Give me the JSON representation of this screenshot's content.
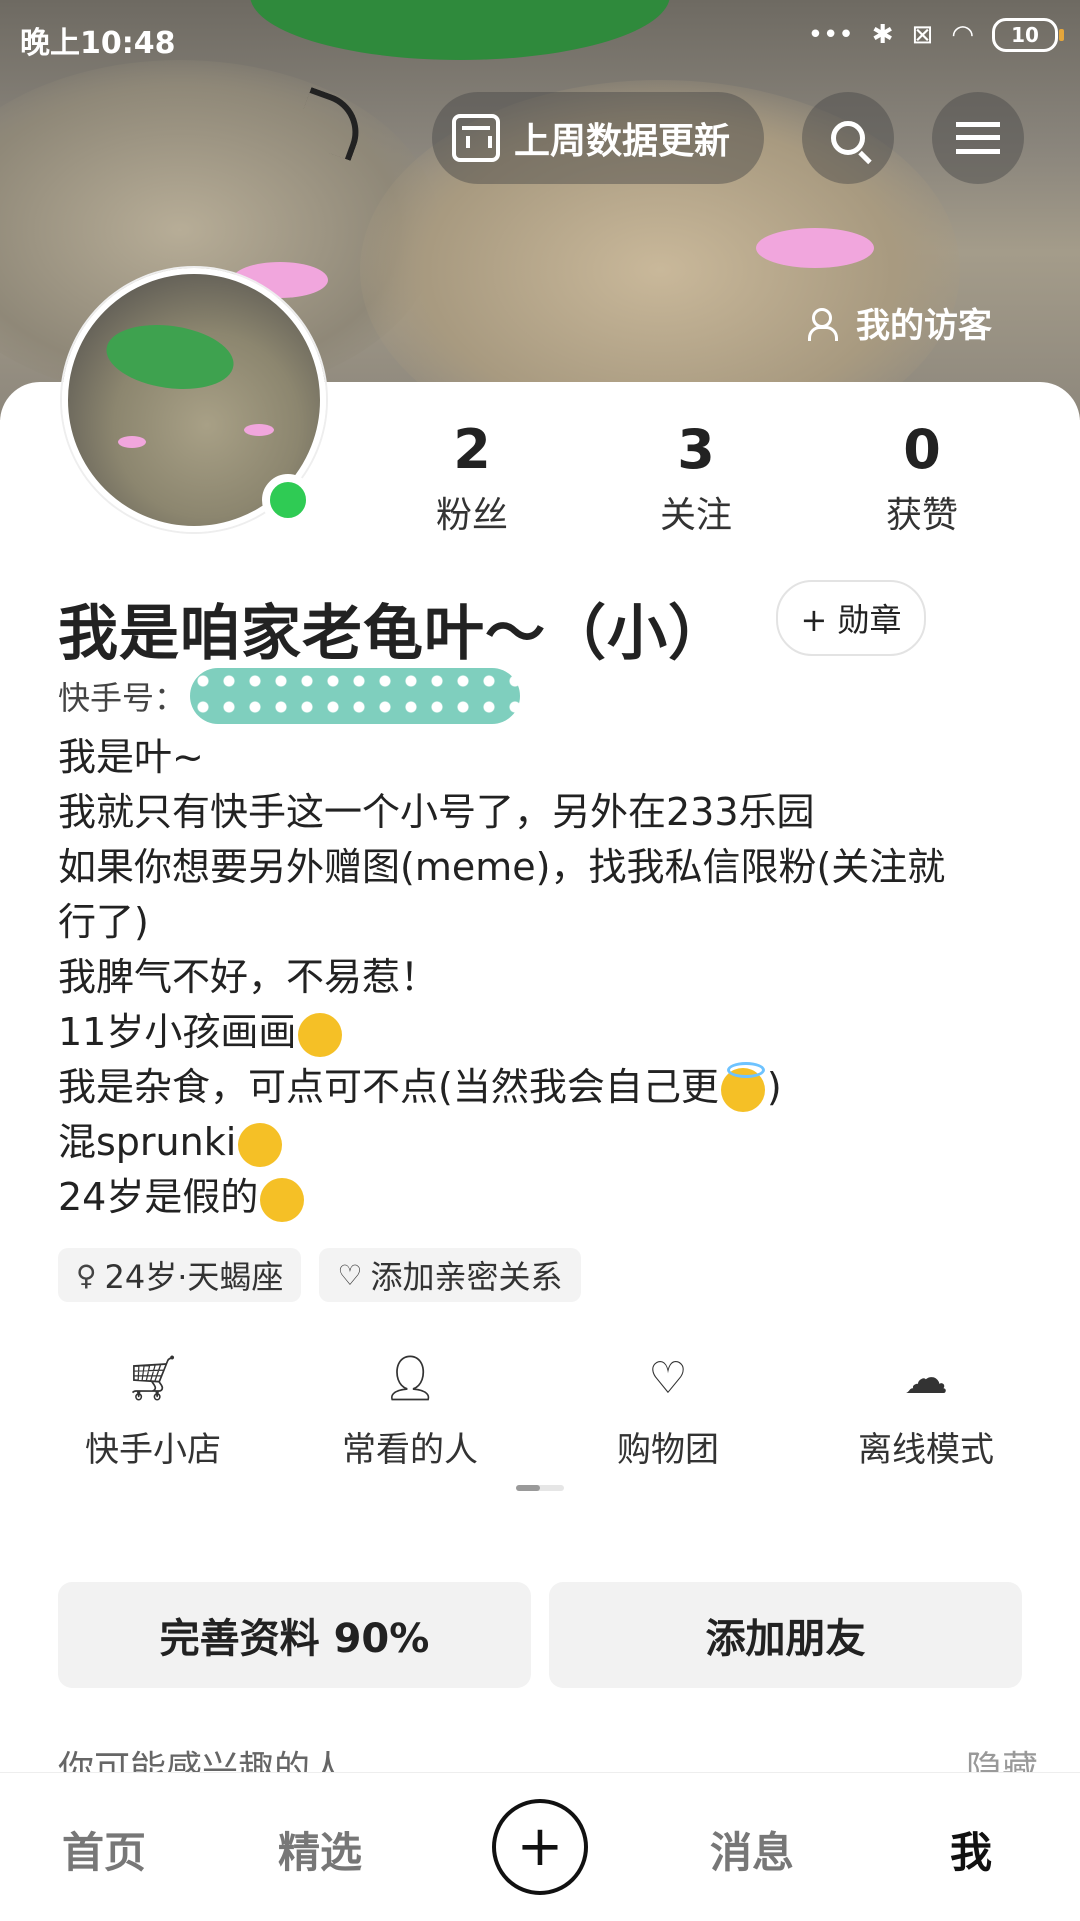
{
  "status_bar": {
    "time": "晚上10:48",
    "battery": "10"
  },
  "header": {
    "data_update_label": "上周数据更新",
    "visitor_label": "我的访客"
  },
  "profile": {
    "stats": [
      {
        "value": "2",
        "label": "粉丝"
      },
      {
        "value": "3",
        "label": "关注"
      },
      {
        "value": "0",
        "label": "获赞"
      }
    ],
    "name": "我是咱家老龟叶～（小）",
    "medal_label": "+ 勋章",
    "kuaishou_id_label": "快手号：",
    "bio_lines": [
      "我是叶~",
      "我就只有快手这一个小号了，另外在233乐园",
      "如果你想要另外赠图(meme)，找我私信限粉(关注就",
      "行了)",
      "我脾气不好，不易惹！",
      "11岁小孩画画",
      "我是杂食，可点可不点(当然我会自己更",
      ")",
      "混sprunki",
      "24岁是假的"
    ],
    "tags": [
      {
        "icon": "gender-icon",
        "label": "24岁·天蝎座"
      },
      {
        "icon": "heart-link-icon",
        "label": "添加亲密关系"
      }
    ]
  },
  "tools": [
    {
      "icon": "cart-icon",
      "label": "快手小店"
    },
    {
      "icon": "person-clock-icon",
      "label": "常看的人"
    },
    {
      "icon": "heart-icon",
      "label": "购物团"
    },
    {
      "icon": "cloud-download-icon",
      "label": "离线模式"
    }
  ],
  "actions": {
    "complete_profile": "完善资料 90%",
    "add_friend": "添加朋友"
  },
  "suggest": {
    "title": "你可能感兴趣的人",
    "hide": "隐藏"
  },
  "nav": {
    "home": "首页",
    "featured": "精选",
    "plus": "+",
    "messages": "消息",
    "me": "我"
  },
  "colors": {
    "online": "#2fcb54",
    "accent_pink": "#f1a6dd",
    "leaf_green": "#3ea24f"
  }
}
